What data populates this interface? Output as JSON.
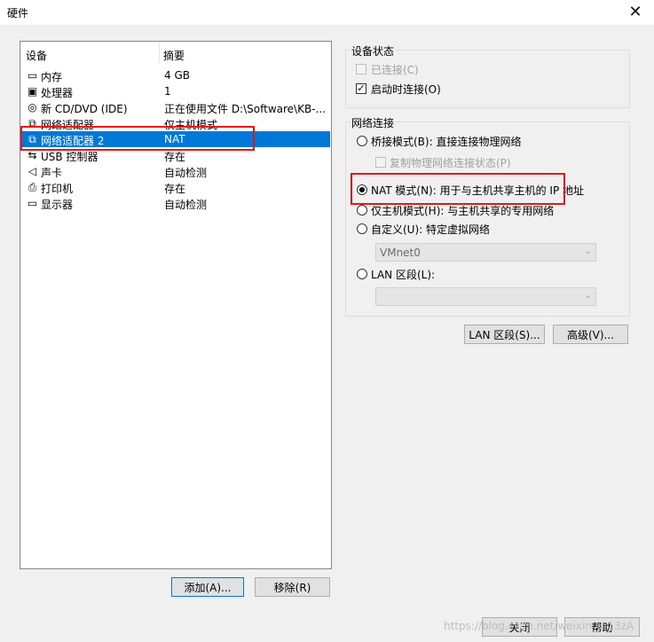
{
  "window": {
    "title": "硬件",
    "close_glyph": "✕"
  },
  "device_list": {
    "headers": {
      "device": "设备",
      "summary": "摘要"
    },
    "items": [
      {
        "icon": "memory-icon",
        "glyph": "▭",
        "name": "内存",
        "summary": "4 GB"
      },
      {
        "icon": "processor-icon",
        "glyph": "▣",
        "name": "处理器",
        "summary": "1"
      },
      {
        "icon": "cd-dvd-icon",
        "glyph": "◎",
        "name": "新 CD/DVD (IDE)",
        "summary": "正在使用文件 D:\\Software\\KB-..."
      },
      {
        "icon": "network-adapter-icon",
        "glyph": "⧉",
        "name": "网络适配器",
        "summary": "仅主机模式"
      },
      {
        "icon": "network-adapter-icon",
        "glyph": "⧉",
        "name": "网络适配器 2",
        "summary": "NAT"
      },
      {
        "icon": "usb-icon",
        "glyph": "⇆",
        "name": "USB 控制器",
        "summary": "存在"
      },
      {
        "icon": "sound-icon",
        "glyph": "◁",
        "name": "声卡",
        "summary": "自动检测"
      },
      {
        "icon": "printer-icon",
        "glyph": "⎙",
        "name": "打印机",
        "summary": "存在"
      },
      {
        "icon": "display-icon",
        "glyph": "▭",
        "name": "显示器",
        "summary": "自动检测"
      }
    ],
    "selected_index": 4
  },
  "buttons": {
    "add": "添加(A)...",
    "remove": "移除(R)",
    "lan_segments": "LAN 区段(S)...",
    "advanced": "高级(V)...",
    "close": "关闭",
    "help": "帮助"
  },
  "device_status": {
    "title": "设备状态",
    "connected": {
      "label": "已连接(C)",
      "checked": false,
      "enabled": false
    },
    "connect_at_power_on": {
      "label": "启动时连接(O)",
      "checked": true,
      "enabled": true
    }
  },
  "network_connection": {
    "title": "网络连接",
    "bridged": {
      "label": "桥接模式(B): 直接连接物理网络",
      "selected": false
    },
    "replicate_state": {
      "label": "复制物理网络连接状态(P)",
      "checked": false,
      "enabled": false
    },
    "nat": {
      "label": "NAT 模式(N): 用于与主机共享主机的 IP 地址",
      "selected": true
    },
    "host_only": {
      "label": "仅主机模式(H): 与主机共享的专用网络",
      "selected": false
    },
    "custom": {
      "label": "自定义(U): 特定虚拟网络",
      "selected": false,
      "dropdown_value": "VMnet0"
    },
    "lan_segment": {
      "label": "LAN 区段(L):",
      "selected": false,
      "dropdown_value": ""
    }
  },
  "watermark": "https://blog.csdn.net/weixin_...13zA"
}
